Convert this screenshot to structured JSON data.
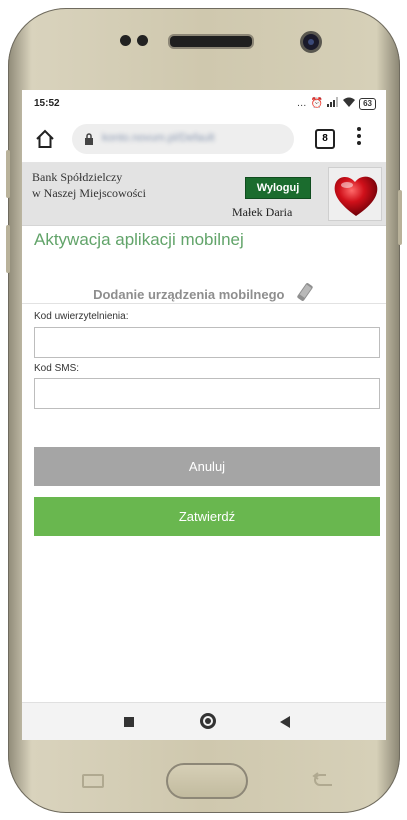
{
  "status_bar": {
    "time": "15:52",
    "signal_glyph": "…",
    "alarm_glyph": "⏰",
    "wifi_glyph": "◥",
    "battery": "63"
  },
  "browser": {
    "url": "konto.novum.pl/Default",
    "tab_count": "8"
  },
  "bank_header": {
    "bank_name_line1": "Bank Spółdzielczy",
    "bank_name_line2": "w Naszej Miejscowości",
    "logout_label": "Wyloguj",
    "user_name": "Małek Daria"
  },
  "page": {
    "title": "Aktywacja aplikacji mobilnej",
    "section_title": "Dodanie urządzenia mobilnego"
  },
  "form": {
    "auth_code_label": "Kod uwierzytelnienia:",
    "auth_code_value": "",
    "sms_code_label": "Kod SMS:",
    "sms_code_value": ""
  },
  "buttons": {
    "cancel_label": "Anuluj",
    "confirm_label": "Zatwierdź"
  },
  "colors": {
    "accent_green": "#69b74f",
    "logout_green": "#1b6c2e",
    "title_green": "#62a46a",
    "cancel_gray": "#a5a5a5"
  }
}
